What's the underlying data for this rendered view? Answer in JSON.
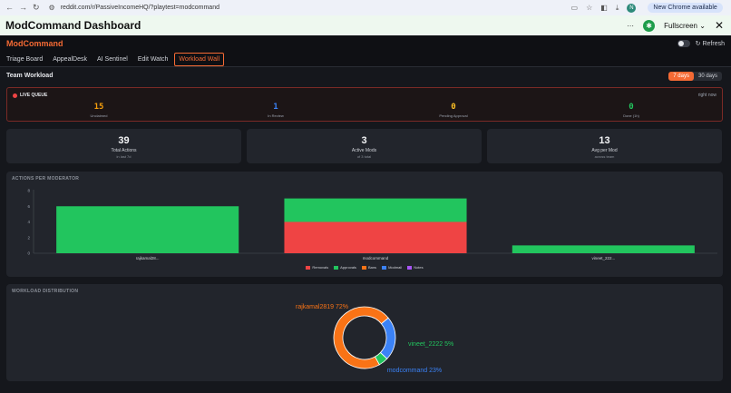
{
  "browser": {
    "url": "reddit.com/r/PassiveIncomeHQ/?playtest=modcommand",
    "avatar_letter": "N",
    "update_label": "New Chrome available"
  },
  "playtest": {
    "title": "ModCommand Dashboard",
    "fullscreen_label": "Fullscreen",
    "more_label": "···"
  },
  "app": {
    "brand": "ModCommand",
    "refresh_label": "Refresh"
  },
  "tabs": [
    {
      "label": "Triage Board"
    },
    {
      "label": "AppealDesk"
    },
    {
      "label": "AI Sentinel"
    },
    {
      "label": "Edit Watch"
    },
    {
      "label": "Workload Wall"
    }
  ],
  "workload": {
    "title": "Team Workload",
    "range": [
      "7 days",
      "30 days"
    ]
  },
  "live_queue": {
    "label": "LIVE QUEUE",
    "time": "right now",
    "stats": [
      {
        "value": "15",
        "caption": "Unclaimed",
        "color": "#f59e0b"
      },
      {
        "value": "1",
        "caption": "In Review",
        "color": "#3b82f6"
      },
      {
        "value": "0",
        "caption": "Pending Approval",
        "color": "#fbbf24"
      },
      {
        "value": "0",
        "caption": "Done (1h)",
        "color": "#22c55e"
      }
    ]
  },
  "summary": [
    {
      "value": "39",
      "caption": "Total Actions",
      "sub": "in last 7d"
    },
    {
      "value": "3",
      "caption": "Active Mods",
      "sub": "of 3 total"
    },
    {
      "value": "13",
      "caption": "Avg per Mod",
      "sub": "across team"
    }
  ],
  "actions_panel": {
    "title": "ACTIONS PER MODERATOR"
  },
  "distribution_panel": {
    "title": "WORKLOAD DISTRIBUTION"
  },
  "chart_data": [
    {
      "type": "bar",
      "stacked": true,
      "categories": [
        "rajkamal28...",
        "modcommand",
        "vineet_222..."
      ],
      "yticks": [
        0,
        2,
        4,
        6,
        8
      ],
      "ylim": [
        0,
        8
      ],
      "series": [
        {
          "name": "Removals",
          "color": "#ef4444",
          "values": [
            0,
            4,
            0
          ]
        },
        {
          "name": "Approvals",
          "color": "#22c55e",
          "values": [
            6,
            3,
            1
          ]
        },
        {
          "name": "Bans",
          "color": "#f97316",
          "values": [
            0,
            0,
            0
          ]
        },
        {
          "name": "Modmail",
          "color": "#3b82f6",
          "values": [
            0,
            0,
            0
          ]
        },
        {
          "name": "Notes",
          "color": "#a855f7",
          "values": [
            0,
            0,
            0
          ]
        }
      ],
      "legend_position": "bottom"
    },
    {
      "type": "pie",
      "donut": true,
      "slices": [
        {
          "label": "rajkamal2819",
          "percent": 72,
          "color": "#f97316",
          "text": "rajkamal2819 72%"
        },
        {
          "label": "vineet_2222",
          "percent": 5,
          "color": "#22c55e",
          "text": "vineet_2222 5%"
        },
        {
          "label": "modcommand",
          "percent": 23,
          "color": "#3b82f6",
          "text": "modcommand 23%"
        }
      ]
    }
  ]
}
